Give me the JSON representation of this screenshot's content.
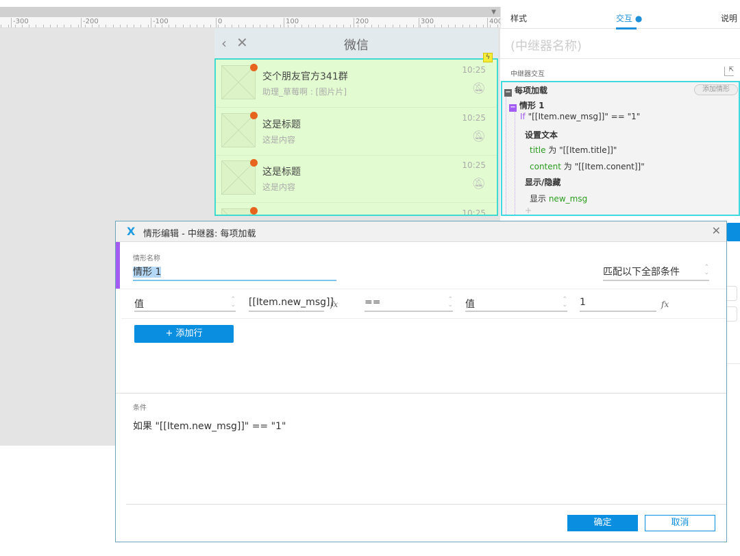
{
  "ruler": {
    "labels": [
      "-300",
      "-200",
      "-100",
      "0",
      "100",
      "200",
      "300",
      "400"
    ]
  },
  "phone": {
    "title": "微信",
    "back_icon": "‹",
    "close_icon": "✕",
    "items": [
      {
        "title": "交个朋友官方341群",
        "subtitle": "助理_草莓啊 : [图片片]",
        "time": "10:25"
      },
      {
        "title": "这是标题",
        "subtitle": "这是内容",
        "time": "10:25"
      },
      {
        "title": "这是标题",
        "subtitle": "这是内容",
        "time": "10:25"
      },
      {
        "title": "短信营销专题",
        "subtitle": "",
        "time": "10:25"
      }
    ]
  },
  "panel": {
    "tabs": {
      "style": "样式",
      "interact": "交互",
      "notes": "说明"
    },
    "name_placeholder": "(中继器名称)",
    "section_label": "中继器交互",
    "event": "每项加载",
    "add_case": "添加情形",
    "case": "情形 1",
    "if_kw": "If",
    "condition": " \"[[Item.new_msg]]\" == \"1\"",
    "action1": "设置文本",
    "a1_t1": "title",
    "a1_v1": " 为 \"[[Item.title]]\"",
    "a1_t2": "content",
    "a1_v2": " 为 \"[[Item.conent]]\"",
    "action2": "显示/隐藏",
    "a2_v": "显示 ",
    "a2_t": "new_msg",
    "plus": "+"
  },
  "dialog": {
    "title": "情形编辑  -  中继器: 每项加载",
    "case_name_label": "情形名称",
    "case_name": "情形 1",
    "match": "匹配以下全部条件",
    "row": {
      "left_type": "值",
      "left_value": "[[Item.new_msg]]",
      "operator": "==",
      "right_type": "值",
      "right_value": "1",
      "fx": "fx"
    },
    "add_row": "+ 添加行",
    "cond_label": "条件",
    "cond_text": "如果 \"[[Item.new_msg]]\" == \"1\"",
    "ok": "确定",
    "cancel": "取消"
  }
}
